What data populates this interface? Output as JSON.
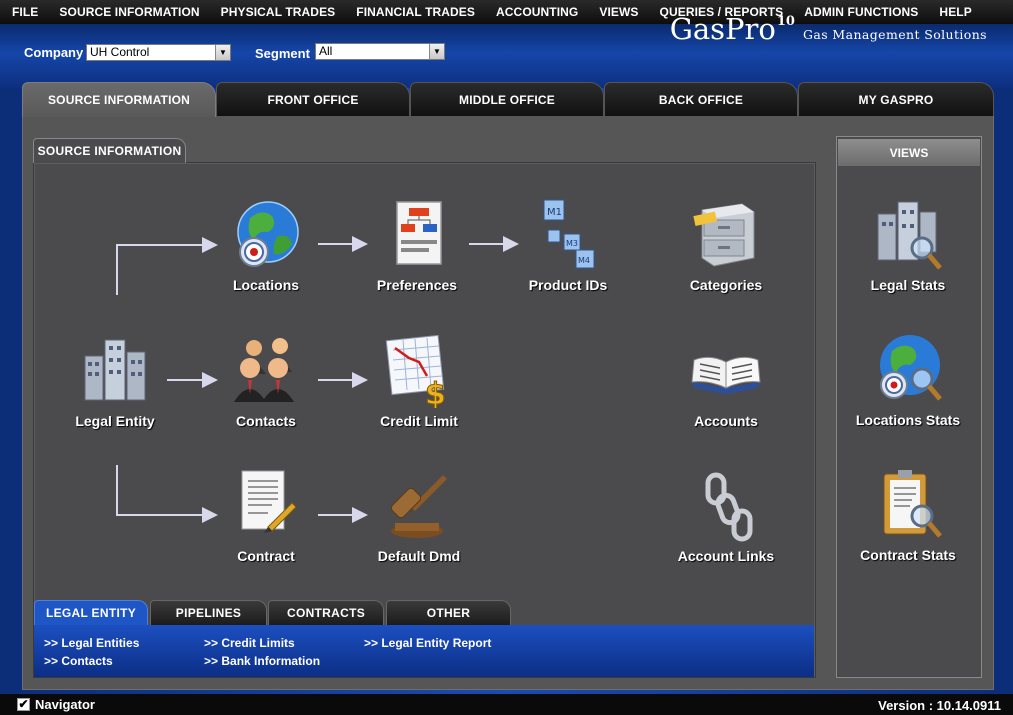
{
  "menu": [
    "FILE",
    "SOURCE INFORMATION",
    "PHYSICAL TRADES",
    "FINANCIAL TRADES",
    "ACCOUNTING",
    "VIEWS",
    "QUERIES / REPORTS",
    "ADMIN FUNCTIONS",
    "HELP"
  ],
  "header": {
    "company_label": "Company",
    "company_value": "UH Control",
    "segment_label": "Segment",
    "segment_value": "All",
    "brand_name": "GasPro",
    "brand_version": "10",
    "brand_tagline": "Gas Management Solutions"
  },
  "top_tabs": [
    "SOURCE INFORMATION",
    "FRONT OFFICE",
    "MIDDLE OFFICE",
    "BACK OFFICE",
    "MY GASPRO"
  ],
  "inner_tab": "SOURCE INFORMATION",
  "nav": {
    "locations": "Locations",
    "preferences": "Preferences",
    "product_ids": "Product IDs",
    "categories": "Categories",
    "legal_entity": "Legal Entity",
    "contacts": "Contacts",
    "credit_limit": "Credit Limit",
    "accounts": "Accounts",
    "contract": "Contract",
    "default_dmd": "Default Dmd",
    "account_links": "Account Links"
  },
  "views": {
    "title": "VIEWS",
    "legal_stats": "Legal Stats",
    "locations_stats": "Locations Stats",
    "contract_stats": "Contract Stats"
  },
  "bottom_tabs": [
    "LEGAL ENTITY",
    "PIPELINES",
    "CONTRACTS",
    "OTHER"
  ],
  "links": {
    "legal_entities": ">> Legal Entities",
    "contacts": ">> Contacts",
    "credit_limits": ">> Credit Limits",
    "bank_information": ">> Bank Information",
    "legal_entity_report": ">> Legal Entity Report"
  },
  "status": {
    "navigator_label": "Navigator",
    "navigator_checked": "✔",
    "version": "Version : 10.14.0911"
  }
}
